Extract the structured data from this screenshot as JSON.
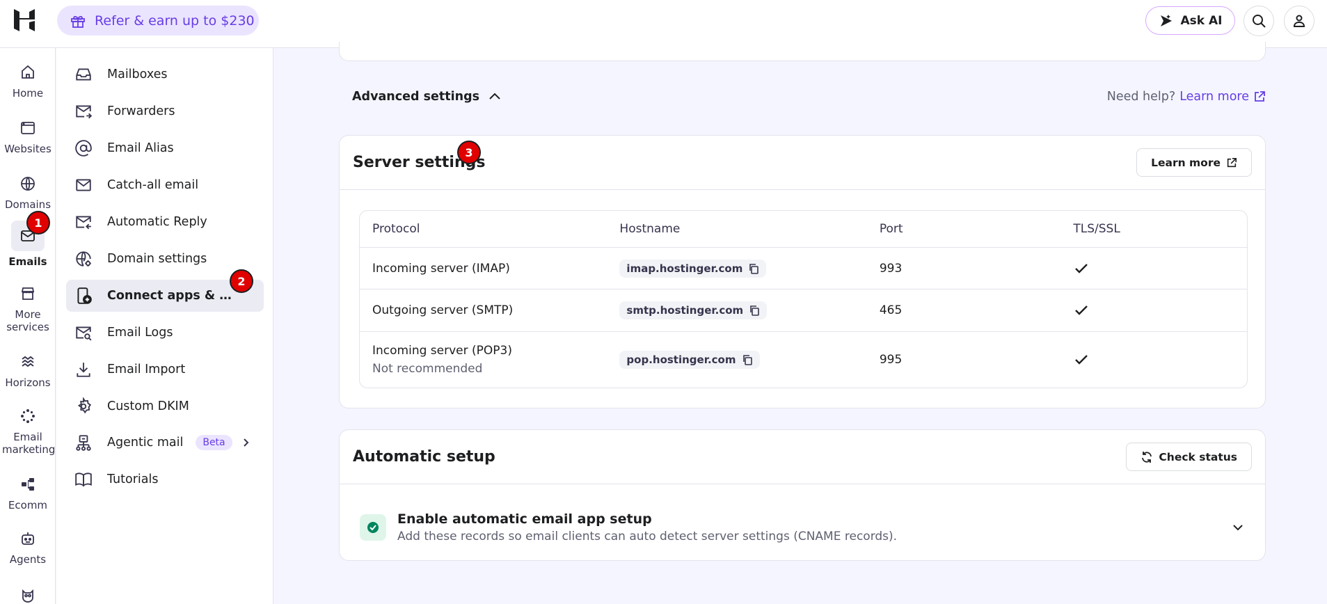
{
  "topbar": {
    "refer_label": "Refer & earn up to $230",
    "askai_label": "Ask AI"
  },
  "rail": {
    "items": [
      {
        "label": "Home",
        "icon": "home-icon"
      },
      {
        "label": "Websites",
        "icon": "websites-icon"
      },
      {
        "label": "Domains",
        "icon": "globe-icon"
      },
      {
        "label": "Emails",
        "icon": "mail-icon",
        "active": true
      },
      {
        "label": "More services",
        "icon": "store-icon"
      },
      {
        "label": "Horizons",
        "icon": "horizons-icon"
      },
      {
        "label": "Email marketing",
        "icon": "email-marketing-icon"
      },
      {
        "label": "Ecomm",
        "icon": "ecomm-icon"
      },
      {
        "label": "Agents",
        "icon": "agents-icon"
      }
    ]
  },
  "sidebar": {
    "items": [
      {
        "label": "Mailboxes",
        "icon": "inbox-icon"
      },
      {
        "label": "Forwarders",
        "icon": "forward-mail-icon"
      },
      {
        "label": "Email Alias",
        "icon": "at-sign-icon"
      },
      {
        "label": "Catch-all email",
        "icon": "mail-icon"
      },
      {
        "label": "Automatic Reply",
        "icon": "auto-reply-icon"
      },
      {
        "label": "Domain settings",
        "icon": "globe-gear-icon"
      },
      {
        "label": "Connect apps & devices",
        "icon": "device-add-icon",
        "active": true
      },
      {
        "label": "Email Logs",
        "icon": "mail-search-icon"
      },
      {
        "label": "Email Import",
        "icon": "download-icon"
      },
      {
        "label": "Custom DKIM",
        "icon": "gear-icon"
      },
      {
        "label": "Agentic mail",
        "icon": "agent-network-icon",
        "badge": "Beta"
      },
      {
        "label": "Tutorials",
        "icon": "book-icon"
      }
    ]
  },
  "markers": [
    "1",
    "2",
    "3"
  ],
  "advanced": {
    "label": "Advanced settings",
    "help_text": "Need help?",
    "help_link": "Learn more"
  },
  "server_settings": {
    "title": "Server settings",
    "learn_more": "Learn more",
    "columns": [
      "Protocol",
      "Hostname",
      "Port",
      "TLS/SSL"
    ],
    "rows": [
      {
        "protocol": "Incoming server (IMAP)",
        "note": "",
        "hostname": "imap.hostinger.com",
        "port": "993",
        "tls": true
      },
      {
        "protocol": "Outgoing server (SMTP)",
        "note": "",
        "hostname": "smtp.hostinger.com",
        "port": "465",
        "tls": true
      },
      {
        "protocol": "Incoming server (POP3)",
        "note": "Not recommended",
        "hostname": "pop.hostinger.com",
        "port": "995",
        "tls": true
      }
    ]
  },
  "automatic_setup": {
    "title": "Automatic setup",
    "check_status": "Check status",
    "item_title": "Enable automatic email app setup",
    "item_desc": "Add these records so email clients can auto detect server settings (CNAME records)."
  },
  "colors": {
    "accent": "#673de6",
    "marker": "#e00000",
    "success": "#00b090"
  }
}
